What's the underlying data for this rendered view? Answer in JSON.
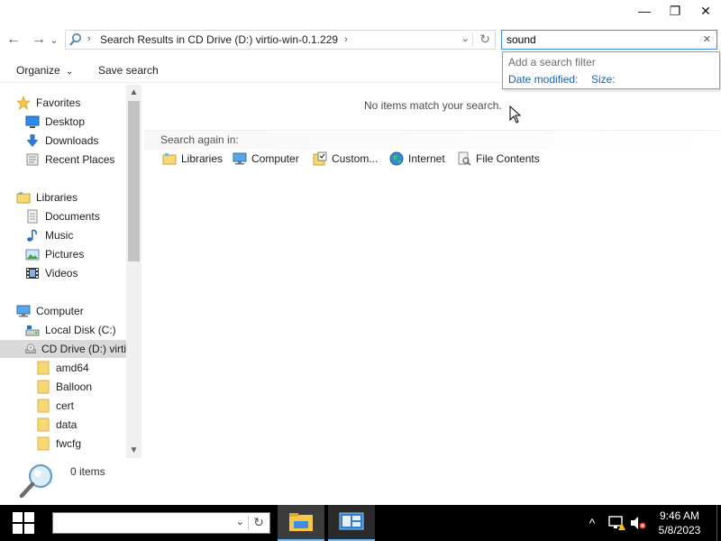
{
  "window": {
    "controls": {
      "minimize": "—",
      "restore": "❐",
      "close": "✕"
    }
  },
  "nav": {
    "back": "←",
    "forward": "→",
    "recent": "⌄",
    "address_path": "Search Results in CD Drive (D:) virtio-win-0.1.229",
    "address_chevron": "›",
    "address_dropdown": "⌄",
    "refresh": "↻"
  },
  "search": {
    "value": "sound",
    "clear": "✕",
    "filter_title": "Add a search filter",
    "filters": [
      "Date modified:",
      "Size:"
    ]
  },
  "toolbar": {
    "organize": "Organize",
    "organize_arrow": "⌄",
    "save_search": "Save search"
  },
  "navpane": {
    "favorites_label": "Favorites",
    "favorites": [
      "Desktop",
      "Downloads",
      "Recent Places"
    ],
    "libraries_label": "Libraries",
    "libraries": [
      "Documents",
      "Music",
      "Pictures",
      "Videos"
    ],
    "computer_label": "Computer",
    "drives": [
      "Local Disk (C:)",
      "CD Drive (D:) virti"
    ],
    "folders": [
      "amd64",
      "Balloon",
      "cert",
      "data",
      "fwcfg"
    ],
    "scroll_up": "▲",
    "scroll_down": "▼"
  },
  "content": {
    "no_items": "No items match your search.",
    "search_again_label": "Search again in:",
    "search_again": [
      "Libraries",
      "Computer",
      "Custom...",
      "Internet",
      "File Contents"
    ]
  },
  "details": {
    "count": "0 items"
  },
  "taskbar": {
    "search_dropdown": "⌄",
    "search_refresh": "↻",
    "tray_up": "^",
    "clock_time": "9:46 AM",
    "clock_date": "5/8/2023"
  },
  "colors": {
    "accent": "#3d8ee0",
    "link": "#1a5fb4",
    "selection": "#d9d9d9",
    "taskbar": "#000000",
    "folder": "#f8d775"
  }
}
